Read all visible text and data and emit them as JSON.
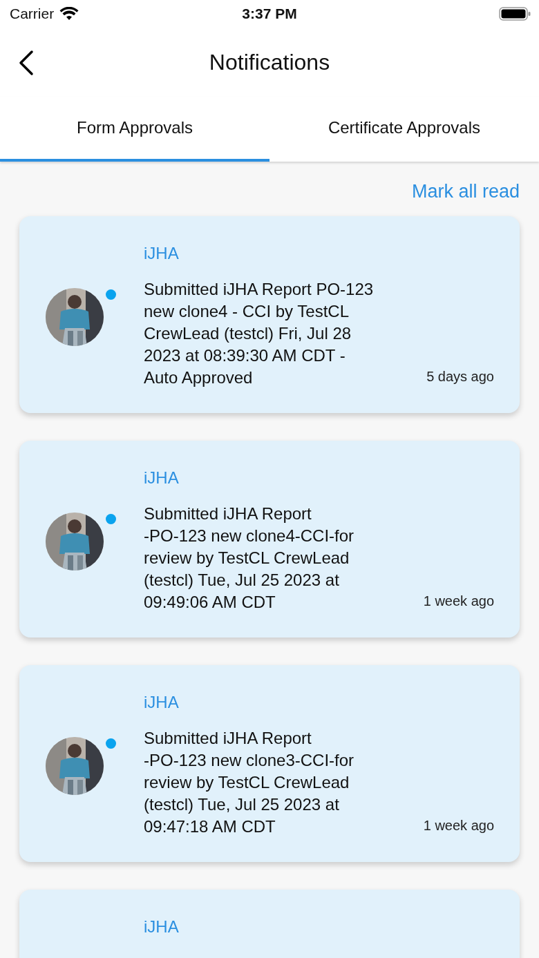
{
  "status_bar": {
    "carrier": "Carrier",
    "time": "3:37 PM"
  },
  "header": {
    "title": "Notifications"
  },
  "tabs": [
    {
      "label": "Form Approvals",
      "selected": true
    },
    {
      "label": "Certificate Approvals",
      "selected": false
    }
  ],
  "mark_all_read": "Mark all read",
  "notifications": [
    {
      "title": "iJHA",
      "unread": true,
      "message": "Submitted iJHA Report PO-123\nnew clone4 - CCI by  TestCL\nCrewLead (testcl) Fri, Jul 28\n2023 at 08:39:30 AM CDT -\nAuto Approved",
      "time": "5 days ago"
    },
    {
      "title": "iJHA",
      "unread": true,
      "message": "Submitted iJHA Report\n-PO-123 new clone4-CCI-for\nreview by TestCL CrewLead\n(testcl) Tue, Jul 25 2023 at\n09:49:06 AM CDT",
      "time": "1 week ago"
    },
    {
      "title": "iJHA",
      "unread": true,
      "message": "Submitted iJHA Report\n-PO-123 new clone3-CCI-for\nreview by TestCL CrewLead\n(testcl) Tue, Jul 25 2023 at\n09:47:18 AM CDT",
      "time": "1 week ago"
    },
    {
      "title": "iJHA"
    }
  ]
}
